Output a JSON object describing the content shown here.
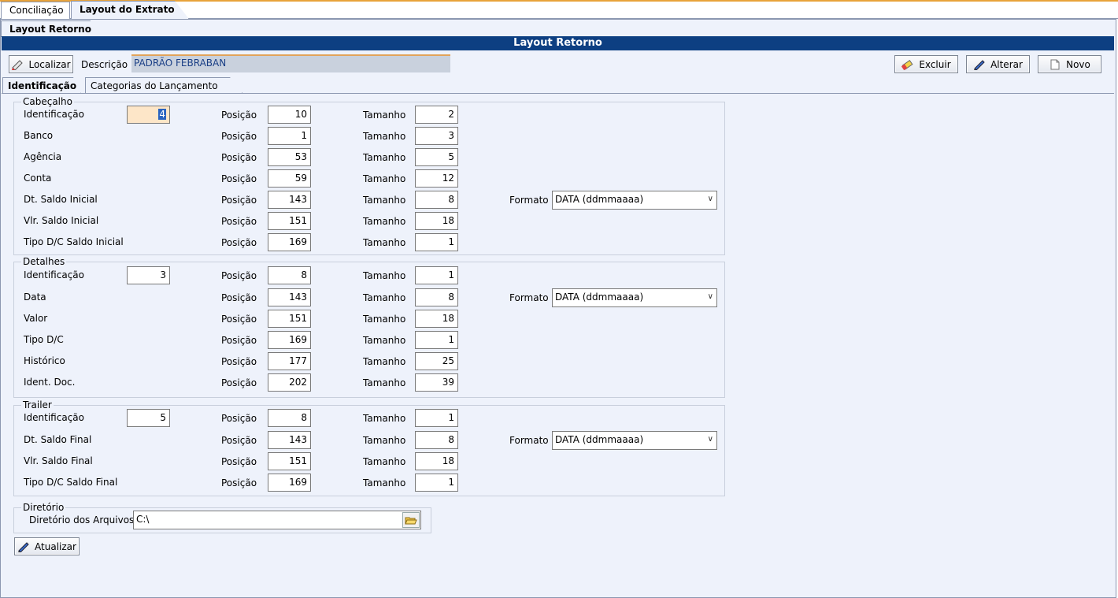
{
  "tabs_top": [
    "Conciliação",
    "Layout do Extrato"
  ],
  "subtab": "Layout Retorno",
  "title": "Layout Retorno",
  "toolbar": {
    "localizar": "Localizar",
    "descricao_label": "Descrição",
    "descricao_value": "PADRÃO FEBRABAN",
    "excluir": "Excluir",
    "alterar": "Alterar",
    "novo": "Novo"
  },
  "inner_tabs": [
    "Identificação",
    "Categorias do Lançamento"
  ],
  "labels": {
    "posicao": "Posição",
    "tamanho": "Tamanho",
    "formato": "Formato"
  },
  "cabecalho": {
    "title": "Cabeçalho",
    "rows": [
      {
        "label": "Identificação",
        "value": "4",
        "pos": "10",
        "tam": "2"
      },
      {
        "label": "Banco",
        "pos": "1",
        "tam": "3"
      },
      {
        "label": "Agência",
        "pos": "53",
        "tam": "5"
      },
      {
        "label": "Conta",
        "pos": "59",
        "tam": "12"
      },
      {
        "label": "Dt. Saldo Inicial",
        "pos": "143",
        "tam": "8",
        "formato": "DATA (ddmmaaaa)"
      },
      {
        "label": "Vlr. Saldo Inicial",
        "pos": "151",
        "tam": "18"
      },
      {
        "label": "Tipo D/C Saldo Inicial",
        "pos": "169",
        "tam": "1"
      }
    ]
  },
  "detalhes": {
    "title": "Detalhes",
    "rows": [
      {
        "label": "Identificação",
        "value": "3",
        "pos": "8",
        "tam": "1"
      },
      {
        "label": "Data",
        "pos": "143",
        "tam": "8",
        "formato": "DATA (ddmmaaaa)"
      },
      {
        "label": "Valor",
        "pos": "151",
        "tam": "18"
      },
      {
        "label": "Tipo D/C",
        "pos": "169",
        "tam": "1"
      },
      {
        "label": "Histórico",
        "pos": "177",
        "tam": "25"
      },
      {
        "label": "Ident. Doc.",
        "pos": "202",
        "tam": "39"
      }
    ]
  },
  "trailer": {
    "title": "Trailer",
    "rows": [
      {
        "label": "Identificação",
        "value": "5",
        "pos": "8",
        "tam": "1"
      },
      {
        "label": "Dt. Saldo Final",
        "pos": "143",
        "tam": "8",
        "formato": "DATA (ddmmaaaa)"
      },
      {
        "label": "Vlr. Saldo Final",
        "pos": "151",
        "tam": "18"
      },
      {
        "label": "Tipo D/C Saldo Final",
        "pos": "169",
        "tam": "1"
      }
    ]
  },
  "diretorio": {
    "title": "Diretório",
    "label": "Diretório dos Arquivos",
    "value": "C:\\"
  },
  "atualizar": "Atualizar"
}
